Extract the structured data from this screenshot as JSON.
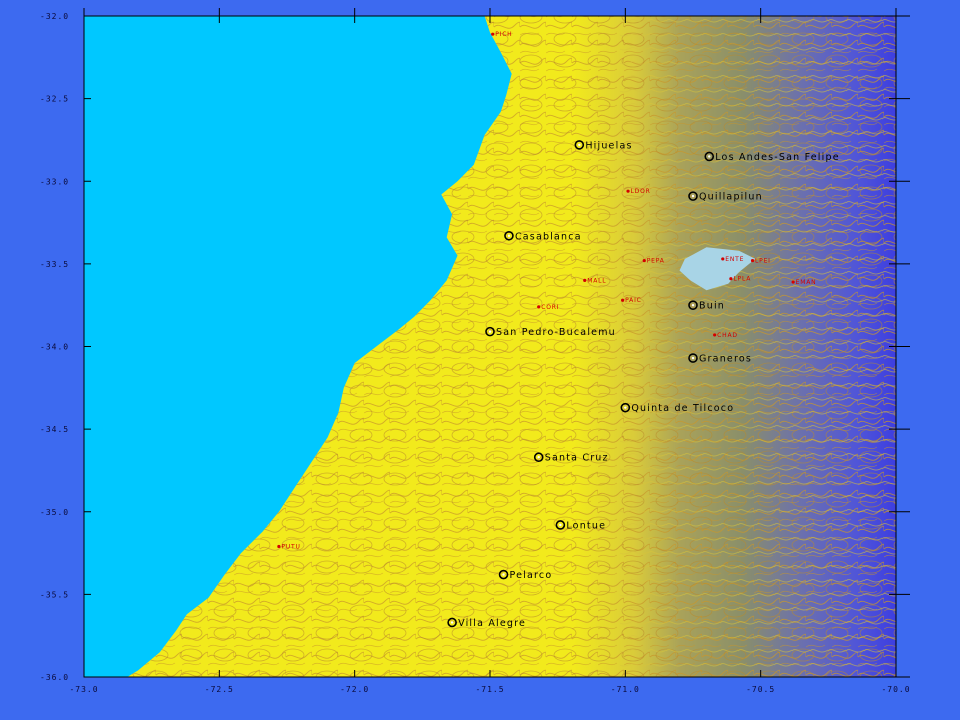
{
  "map": {
    "colors": {
      "background": "#3d6af0",
      "ocean": "#00c8ff",
      "lowland": "#f2ea1c",
      "mountain": "#3d3ee0",
      "contour": "#c8962a",
      "lake": "#a8d4e6",
      "frame": "#000000",
      "station": "#d40000"
    },
    "y_axis_ticks": [
      {
        "value": -32.0,
        "label": "-32.0"
      },
      {
        "value": -32.5,
        "label": "-32.5"
      },
      {
        "value": -33.0,
        "label": "-33.0"
      },
      {
        "value": -33.5,
        "label": "-33.5"
      },
      {
        "value": -34.0,
        "label": "-34.0"
      },
      {
        "value": -34.5,
        "label": "-34.5"
      },
      {
        "value": -35.0,
        "label": "-35.0"
      },
      {
        "value": -35.5,
        "label": "-35.5"
      },
      {
        "value": -36.0,
        "label": "-36.0"
      }
    ],
    "x_axis_ticks": [
      {
        "value": -73.0,
        "label": "-73.0"
      },
      {
        "value": -72.5,
        "label": "-72.5"
      },
      {
        "value": -72.0,
        "label": "-72.0"
      },
      {
        "value": -71.5,
        "label": "-71.5"
      },
      {
        "value": -71.0,
        "label": "-71.0"
      },
      {
        "value": -70.5,
        "label": "-70.5"
      },
      {
        "value": -70.0,
        "label": "-70.0"
      }
    ],
    "cities": [
      {
        "name": "Hijuelas",
        "lon": -71.17,
        "lat": -32.78
      },
      {
        "name": "Los Andes-San Felipe",
        "lon": -70.69,
        "lat": -32.85
      },
      {
        "name": "Quillapilun",
        "lon": -70.75,
        "lat": -33.09
      },
      {
        "name": "Casablanca",
        "lon": -71.43,
        "lat": -33.33
      },
      {
        "name": "Buin",
        "lon": -70.75,
        "lat": -33.75
      },
      {
        "name": "San Pedro-Bucalemu",
        "lon": -71.5,
        "lat": -33.91
      },
      {
        "name": "Graneros",
        "lon": -70.75,
        "lat": -34.07
      },
      {
        "name": "Quinta de Tilcoco",
        "lon": -71.0,
        "lat": -34.37
      },
      {
        "name": "Santa Cruz",
        "lon": -71.32,
        "lat": -34.67
      },
      {
        "name": "Lontue",
        "lon": -71.24,
        "lat": -35.08
      },
      {
        "name": "Pelarco",
        "lon": -71.45,
        "lat": -35.38
      },
      {
        "name": "Villa Alegre",
        "lon": -71.64,
        "lat": -35.67
      }
    ],
    "stations": [
      {
        "code": "PICH",
        "lon": -71.49,
        "lat": -32.11
      },
      {
        "code": "LDOR",
        "lon": -70.99,
        "lat": -33.06
      },
      {
        "code": "PEPA",
        "lon": -70.93,
        "lat": -33.48
      },
      {
        "code": "ENTE",
        "lon": -70.64,
        "lat": -33.47
      },
      {
        "code": "LPEI",
        "lon": -70.53,
        "lat": -33.48
      },
      {
        "code": "MALL",
        "lon": -71.15,
        "lat": -33.6
      },
      {
        "code": "LPLA",
        "lon": -70.61,
        "lat": -33.59
      },
      {
        "code": "EMAN",
        "lon": -70.38,
        "lat": -33.61
      },
      {
        "code": "PAIC",
        "lon": -71.01,
        "lat": -33.72
      },
      {
        "code": "CORI",
        "lon": -71.32,
        "lat": -33.76
      },
      {
        "code": "CHAD",
        "lon": -70.67,
        "lat": -33.93
      },
      {
        "code": "PUTU",
        "lon": -72.28,
        "lat": -35.21
      }
    ]
  }
}
